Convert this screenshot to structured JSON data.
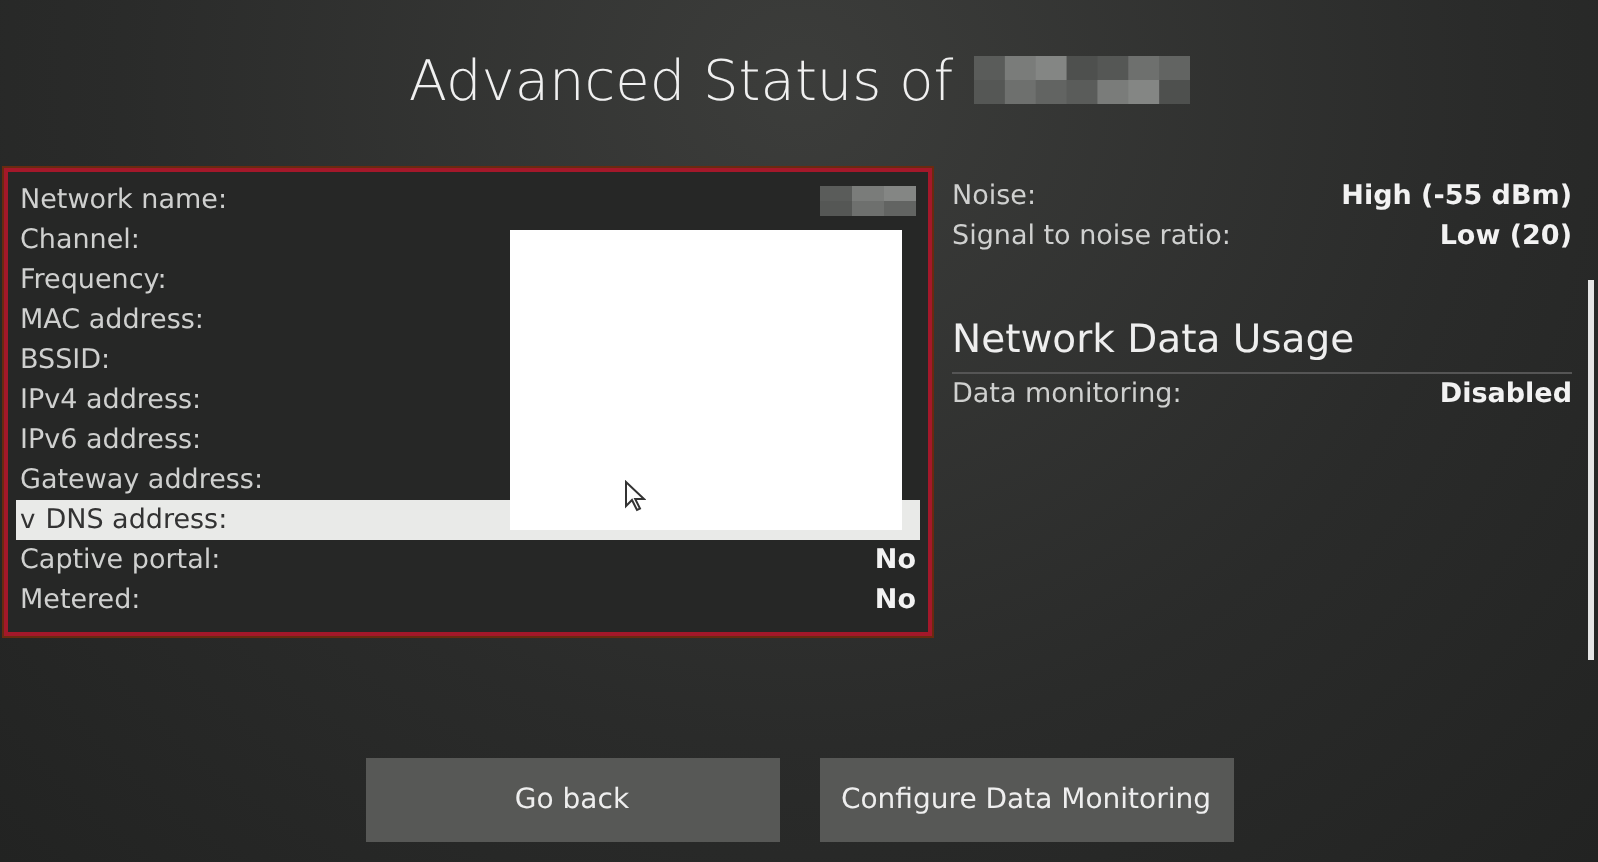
{
  "title": "Advanced Status of",
  "details": [
    {
      "label": "Network name:",
      "value_redacted": true,
      "selected": false
    },
    {
      "label": "Channel:",
      "selected": false
    },
    {
      "label": "Frequency:",
      "selected": false
    },
    {
      "label": "MAC address:",
      "selected": false
    },
    {
      "label": "BSSID:",
      "selected": false
    },
    {
      "label": "IPv4 address:",
      "selected": false
    },
    {
      "label": "IPv6 address:",
      "selected": false
    },
    {
      "label": "Gateway address:",
      "selected": false
    },
    {
      "label": "DNS address:",
      "caret": "v",
      "selected": true
    },
    {
      "label": "Captive portal:",
      "value": "No",
      "selected": false
    },
    {
      "label": "Metered:",
      "value": "No",
      "selected": false
    }
  ],
  "signal": [
    {
      "label": "Noise:",
      "value": "High (-55 dBm)"
    },
    {
      "label": "Signal to noise ratio:",
      "value": "Low (20)"
    }
  ],
  "usage": {
    "heading": "Network Data Usage",
    "rows": [
      {
        "label": "Data monitoring:",
        "value": "Disabled"
      }
    ]
  },
  "buttons": [
    "Go back",
    "Configure Data Monitoring"
  ]
}
